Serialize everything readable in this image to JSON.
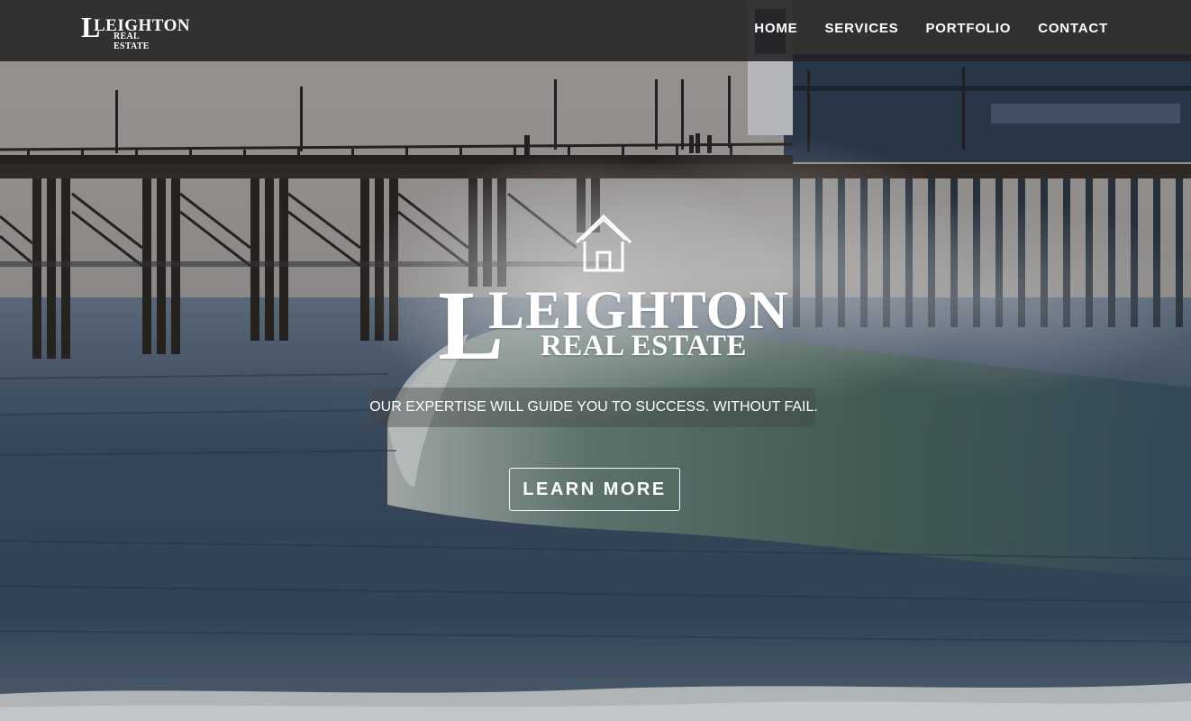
{
  "nav": {
    "logo": {
      "icon": "leighton-logo",
      "name": "LEIGHTON",
      "sub": "REAL ESTATE"
    },
    "items": [
      {
        "label": "HOME"
      },
      {
        "label": "SERVICES"
      },
      {
        "label": "PORTFOLIO"
      },
      {
        "label": "CONTACT"
      }
    ]
  },
  "hero": {
    "icon": "house-icon",
    "brand_name": "LEIGHTON",
    "brand_sub": "REAL ESTATE",
    "tagline": "OUR EXPERTISE WILL GUIDE YOU TO SUCCESS. WITHOUT FAIL.",
    "cta_label": "LEARN MORE"
  },
  "colors": {
    "nav_bg": "#232323",
    "text": "#ffffff",
    "sea": "#3a4c60",
    "sky": "#b9b3ad"
  }
}
